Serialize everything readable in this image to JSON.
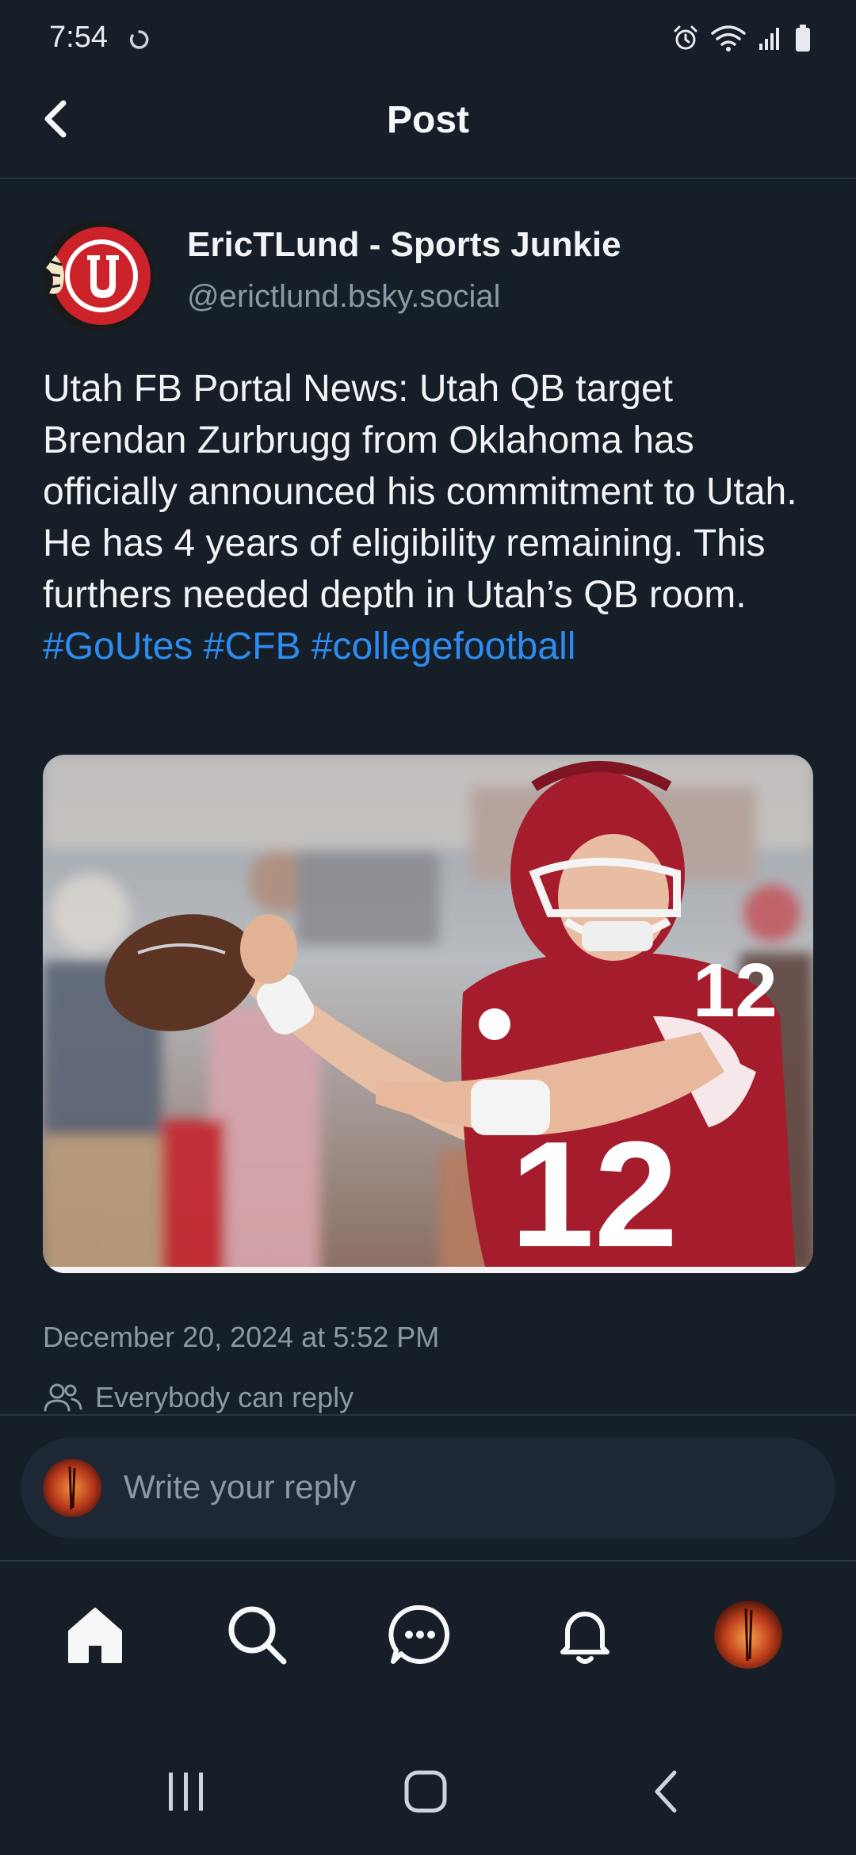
{
  "status_bar": {
    "time": "7:54",
    "icons": [
      "sync-icon",
      "alarm-icon",
      "wifi-icon",
      "signal-icon",
      "battery-icon"
    ]
  },
  "header": {
    "title": "Post",
    "back_icon": "chevron-left-icon"
  },
  "post": {
    "author": {
      "display_name": "EricTLund - Sports Junkie",
      "handle": "@erictlund.bsky.social",
      "avatar": "utah-utes-logo"
    },
    "text": "Utah FB Portal News: Utah QB target Brendan Zurbrugg from Oklahoma has officially announced his commitment to Utah. He has 4 years of eligibility remaining. This furthers needed depth in Utah’s QB room.",
    "hashtags": [
      "#GoUtes",
      "#CFB",
      "#collegefootball"
    ],
    "image": "football-player-photo",
    "timestamp": "December 20, 2024 at 5:52 PM",
    "reply_permission": "Everybody can reply"
  },
  "reply": {
    "placeholder": "Write your reply"
  },
  "bottom_nav": {
    "items": [
      "home-icon",
      "search-icon",
      "chat-icon",
      "bell-icon",
      "profile-avatar"
    ]
  },
  "system_nav": {
    "items": [
      "recents-icon",
      "home-circle-icon",
      "back-icon"
    ]
  },
  "colors": {
    "background": "#161e27",
    "accent": "#2d8cf0",
    "muted_text": "#8c98a5",
    "reply_box": "#1e2835"
  }
}
